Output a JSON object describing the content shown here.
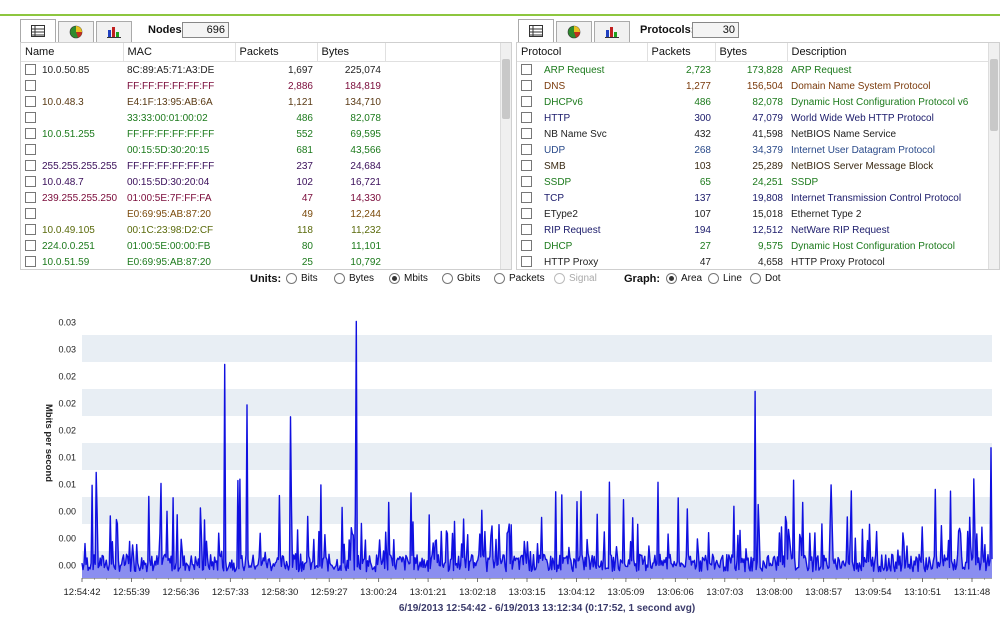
{
  "left_panel": {
    "tabs": [
      {
        "icon": "table-icon"
      },
      {
        "icon": "pie-chart-icon"
      },
      {
        "icon": "bar-chart-icon"
      }
    ],
    "counter_label": "Nodes:",
    "counter_value": "696",
    "columns": [
      "Name",
      "MAC",
      "Packets",
      "Bytes"
    ],
    "rows": [
      {
        "name": "10.0.50.85",
        "mac": "8C:89:A5:71:A3:DE",
        "packets": "1,697",
        "bytes": "225,074",
        "color": "#222222"
      },
      {
        "name": "",
        "mac": "FF:FF:FF:FF:FF:FF",
        "packets": "2,886",
        "bytes": "184,819",
        "color": "#7a0b3a"
      },
      {
        "name": "10.0.48.3",
        "mac": "E4:1F:13:95:AB:6A",
        "packets": "1,121",
        "bytes": "134,710",
        "color": "#5a3a14"
      },
      {
        "name": "",
        "mac": "33:33:00:01:00:02",
        "packets": "486",
        "bytes": "82,078",
        "color": "#1c7a1c"
      },
      {
        "name": "10.0.51.255",
        "mac": "FF:FF:FF:FF:FF:FF",
        "packets": "552",
        "bytes": "69,595",
        "color": "#1c7a1c"
      },
      {
        "name": "",
        "mac": "00:15:5D:30:20:15",
        "packets": "681",
        "bytes": "43,566",
        "color": "#1c7a1c"
      },
      {
        "name": "255.255.255.255",
        "mac": "FF:FF:FF:FF:FF:FF",
        "packets": "237",
        "bytes": "24,684",
        "color": "#3a0f5a"
      },
      {
        "name": "10.0.48.7",
        "mac": "00:15:5D:30:20:04",
        "packets": "102",
        "bytes": "16,721",
        "color": "#3a0f5a"
      },
      {
        "name": "239.255.255.250",
        "mac": "01:00:5E:7F:FF:FA",
        "packets": "47",
        "bytes": "14,330",
        "color": "#7a0b3a"
      },
      {
        "name": "",
        "mac": "E0:69:95:AB:87:20",
        "packets": "49",
        "bytes": "12,244",
        "color": "#7a4a0b"
      },
      {
        "name": "10.0.49.105",
        "mac": "00:1C:23:98:D2:CF",
        "packets": "118",
        "bytes": "11,232",
        "color": "#5a6a0b"
      },
      {
        "name": "224.0.0.251",
        "mac": "01:00:5E:00:00:FB",
        "packets": "80",
        "bytes": "11,101",
        "color": "#1c7a1c"
      },
      {
        "name": "10.0.51.59",
        "mac": "E0:69:95:AB:87:20",
        "packets": "25",
        "bytes": "10,792",
        "color": "#1c7a1c"
      }
    ]
  },
  "right_panel": {
    "tabs": [
      {
        "icon": "table-icon"
      },
      {
        "icon": "pie-chart-icon"
      },
      {
        "icon": "bar-chart-icon"
      }
    ],
    "counter_label": "Protocols:",
    "counter_value": "30",
    "columns": [
      "Protocol",
      "Packets",
      "Bytes",
      "Description"
    ],
    "rows": [
      {
        "protocol": "ARP Request",
        "packets": "2,723",
        "bytes": "173,828",
        "description": "ARP Request",
        "color": "#1c7a1c"
      },
      {
        "protocol": "DNS",
        "packets": "1,277",
        "bytes": "156,504",
        "description": "Domain Name System Protocol",
        "color": "#7a3a0b"
      },
      {
        "protocol": "DHCPv6",
        "packets": "486",
        "bytes": "82,078",
        "description": "Dynamic Host Configuration Protocol v6",
        "color": "#1c7a1c"
      },
      {
        "protocol": "HTTP",
        "packets": "300",
        "bytes": "47,079",
        "description": "World Wide Web HTTP Protocol",
        "color": "#1a1a6a"
      },
      {
        "protocol": "NB Name Svc",
        "packets": "432",
        "bytes": "41,598",
        "description": "NetBIOS Name Service",
        "color": "#222222"
      },
      {
        "protocol": "UDP",
        "packets": "268",
        "bytes": "34,379",
        "description": "Internet User Datagram Protocol",
        "color": "#2a4a8a"
      },
      {
        "protocol": "SMB",
        "packets": "103",
        "bytes": "25,289",
        "description": "NetBIOS Server Message Block",
        "color": "#3a2a14"
      },
      {
        "protocol": "SSDP",
        "packets": "65",
        "bytes": "24,251",
        "description": "SSDP",
        "color": "#1c7a1c"
      },
      {
        "protocol": "TCP",
        "packets": "137",
        "bytes": "19,808",
        "description": "Internet Transmission Control Protocol",
        "color": "#1a1a6a"
      },
      {
        "protocol": "EType2",
        "packets": "107",
        "bytes": "15,018",
        "description": "Ethernet Type 2",
        "color": "#222222"
      },
      {
        "protocol": "RIP Request",
        "packets": "194",
        "bytes": "12,512",
        "description": "NetWare RIP Request",
        "color": "#1a1a6a"
      },
      {
        "protocol": "DHCP",
        "packets": "27",
        "bytes": "9,575",
        "description": "Dynamic Host Configuration Protocol",
        "color": "#1c7a1c"
      },
      {
        "protocol": "HTTP Proxy",
        "packets": "47",
        "bytes": "4,658",
        "description": "HTTP Proxy Protocol",
        "color": "#222222"
      }
    ]
  },
  "controls": {
    "units_label": "Units:",
    "units": [
      "Bits",
      "Bytes",
      "Mbits",
      "Gbits",
      "Packets",
      "Signal"
    ],
    "units_selected": "Mbits",
    "graph_label": "Graph:",
    "graph_types": [
      "Area",
      "Line",
      "Dot"
    ],
    "graph_selected": "Area"
  },
  "chart_data": {
    "type": "area",
    "ylabel": "Mbits per second",
    "y_ticks": [
      "0.03",
      "0.03",
      "0.02",
      "0.02",
      "0.02",
      "0.01",
      "0.01",
      "0.00",
      "0.00",
      "0.00"
    ],
    "x_ticks": [
      "12:54:42",
      "12:55:39",
      "12:56:36",
      "12:57:33",
      "12:58:30",
      "12:59:27",
      "13:00:24",
      "13:01:21",
      "13:02:18",
      "13:03:15",
      "13:04:12",
      "13:05:09",
      "13:06:06",
      "13:07:03",
      "13:08:00",
      "13:08:57",
      "13:09:54",
      "13:10:51",
      "13:11:48"
    ],
    "caption": "6/19/2013 12:54:42 - 6/19/2013 13:12:34  (0:17:52, 1 second avg)",
    "ylim": [
      0,
      0.034
    ],
    "peaks": [
      {
        "t": "12:54:58",
        "value": 0.0133
      },
      {
        "t": "12:57:26",
        "value": 0.0269
      },
      {
        "t": "12:57:52",
        "value": 0.0218
      },
      {
        "t": "12:58:42",
        "value": 0.0203
      },
      {
        "t": "12:59:58",
        "value": 0.0323
      },
      {
        "t": "13:07:38",
        "value": 0.0235
      },
      {
        "t": "13:12:10",
        "value": 0.0164
      }
    ],
    "color_line": "#1010e0",
    "color_fill": "#8a8ef0",
    "color_band": "#e8eef4"
  }
}
